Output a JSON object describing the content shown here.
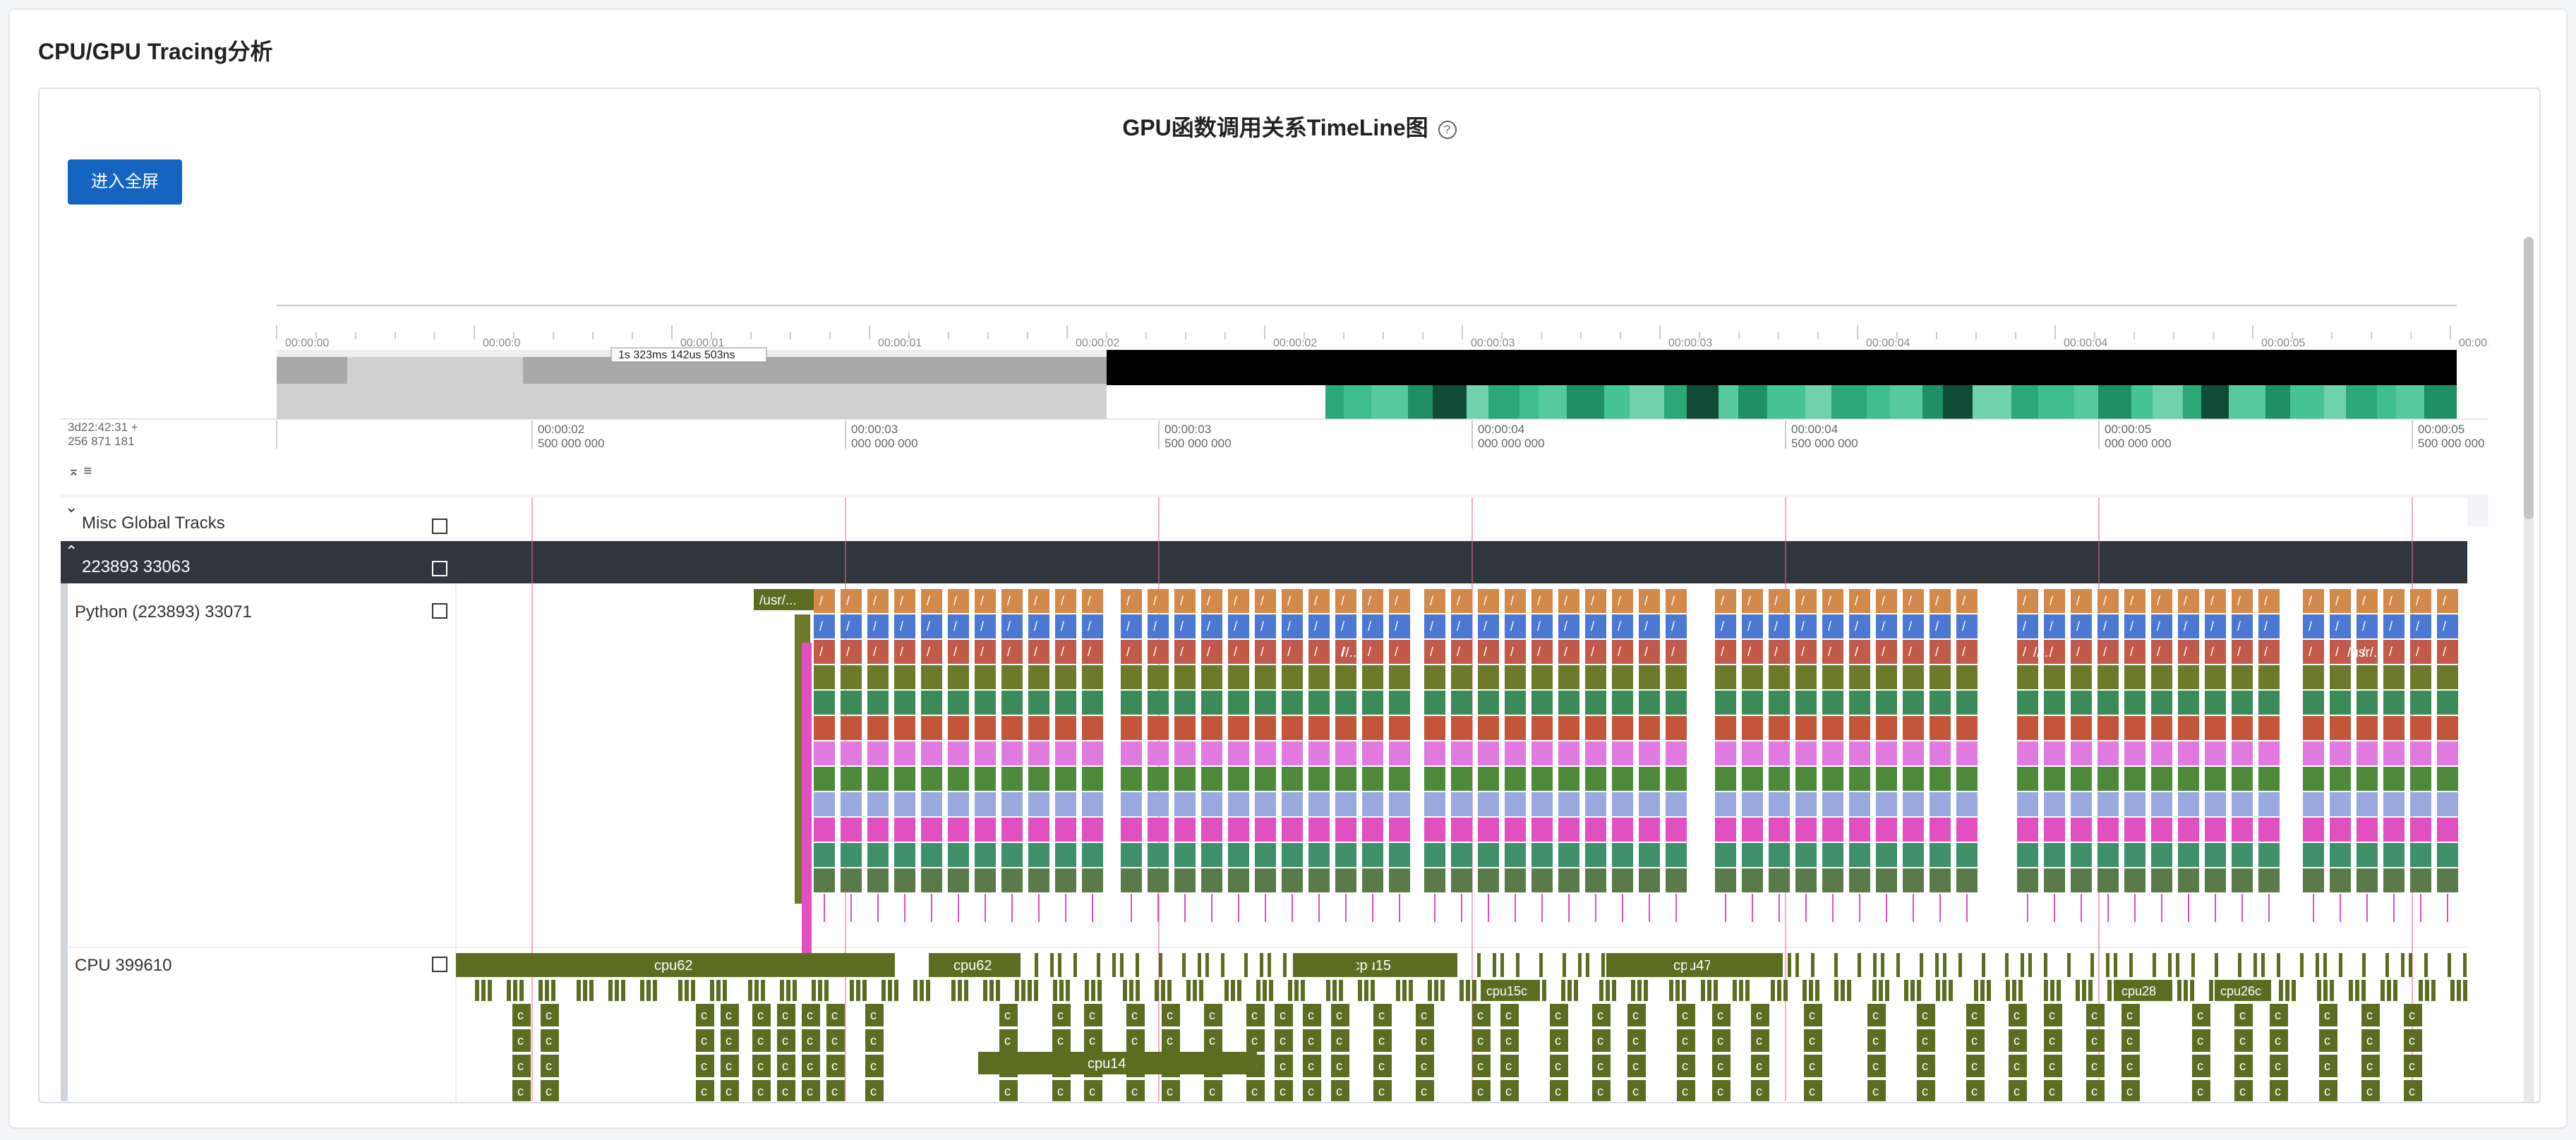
{
  "page": {
    "title": "CPU/GPU Tracing分析"
  },
  "chart": {
    "title": "GPU函数调用关系TimeLine图",
    "help_icon": "question-circle-icon",
    "fullscreen_label": "进入全屏"
  },
  "overview": {
    "tick_labels": [
      "00:00:00",
      "00:00:0",
      "00:00:01",
      "00:00:01",
      "00:00:02",
      "00:00:02",
      "00:00:03",
      "00:00:03",
      "00:00:04",
      "00:00:04",
      "00:00:05",
      "00:00:05"
    ],
    "selection_label": "1s 323ms 142us 503ns"
  },
  "time_axis": {
    "origin_top": "3d22:42:31 +",
    "origin_bottom": "256 871 181",
    "ticks": [
      {
        "top": "00:00:02",
        "bottom": "500 000 000"
      },
      {
        "top": "00:00:03",
        "bottom": "000 000 000"
      },
      {
        "top": "00:00:03",
        "bottom": "500 000 000"
      },
      {
        "top": "00:00:04",
        "bottom": "000 000 000"
      },
      {
        "top": "00:00:04",
        "bottom": "500 000 000"
      },
      {
        "top": "00:00:05",
        "bottom": "000 000 000"
      },
      {
        "top": "00:00:05",
        "bottom": "500 000 000"
      }
    ],
    "toolbar_glyphs": "⌅ ≡"
  },
  "tracks": {
    "misc_label": "Misc Global Tracks",
    "misc_expand_icon": "chevron-down-icon",
    "process_label": "223893 33063",
    "process_expand_icon": "chevron-up-icon",
    "python_label": "Python (223893) 33071",
    "python_first_slice": "/usr/...",
    "python_slice_glyph": "/",
    "python_slice_labels": [
      "//...",
      "//...",
      "/usr/..."
    ],
    "cpu_label": "CPU 399610",
    "cpu_glyph": "c",
    "cpu_slice_labels": [
      "cpu62",
      "cpu62",
      "cpu15",
      "cpu47",
      "cpu14",
      "cpu15c",
      "cpu28",
      "cpu26c"
    ]
  },
  "colors": {
    "accent": "#1565c0",
    "track_dark": "#2f3640",
    "cpu_slice": "#5c6d22",
    "overview_green": "#3fbf8f",
    "vsync_line": "#f06292"
  }
}
